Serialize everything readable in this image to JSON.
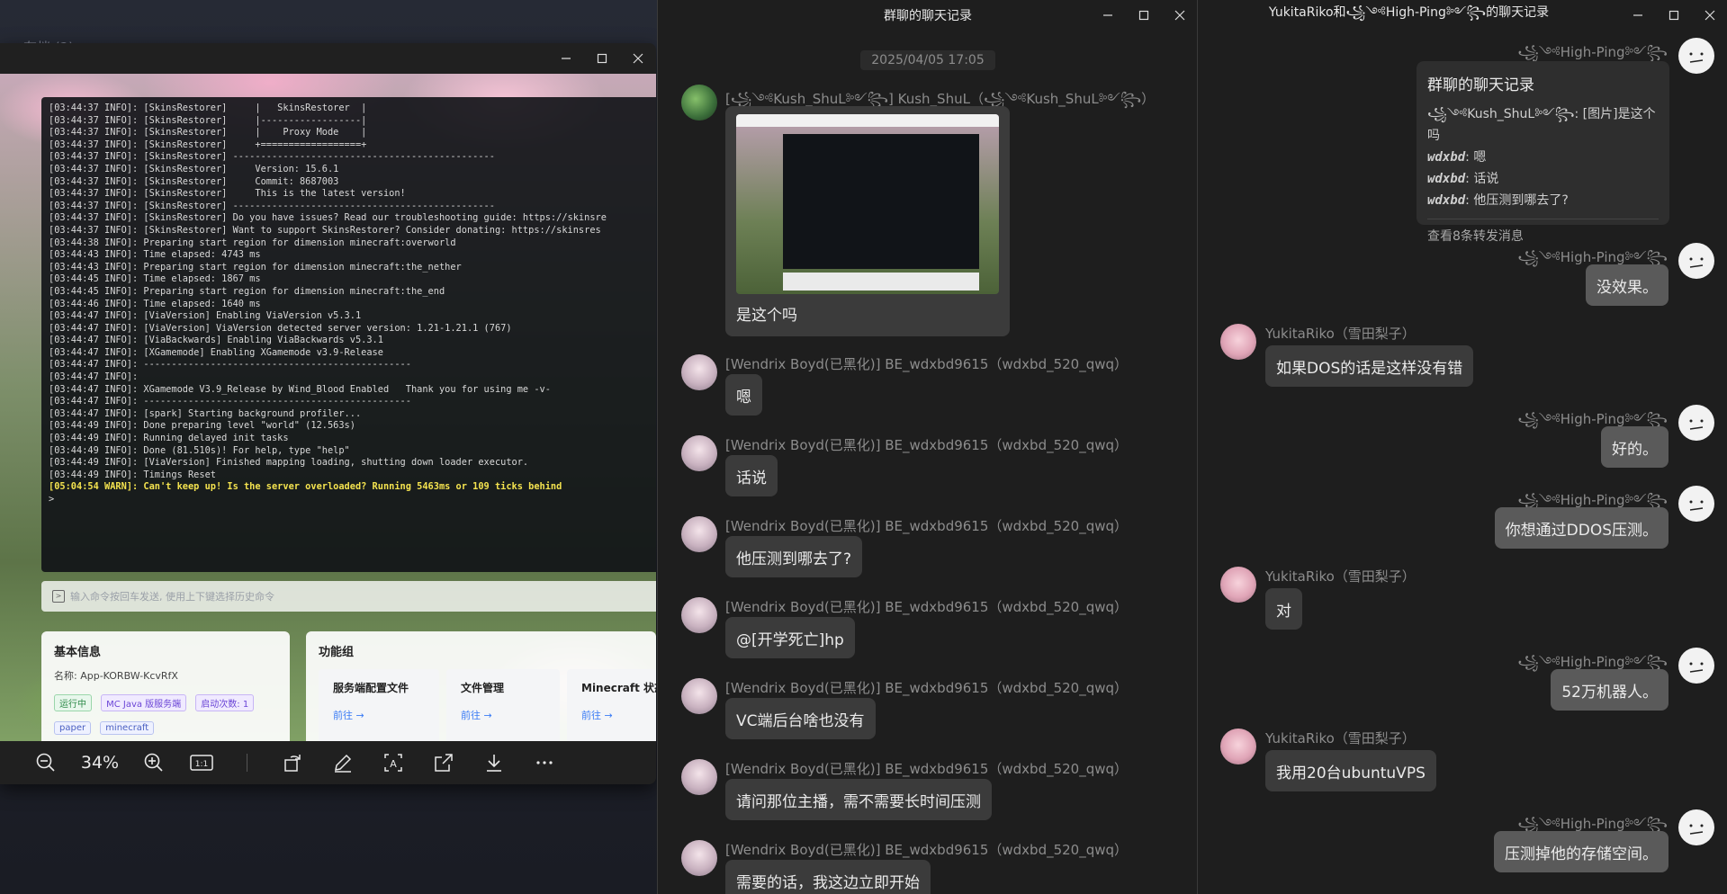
{
  "desktop": {
    "label": "存档 (2)"
  },
  "viewer": {
    "zoom": "34%",
    "console_lines": [
      "[03:44:37 INFO]: [SkinsRestorer]     |   SkinsRestorer  |",
      "[03:44:37 INFO]: [SkinsRestorer]     |------------------|",
      "[03:44:37 INFO]: [SkinsRestorer]     |    Proxy Mode    |",
      "[03:44:37 INFO]: [SkinsRestorer]     +==================+",
      "[03:44:37 INFO]: [SkinsRestorer] -----------------------------------------------",
      "[03:44:37 INFO]: [SkinsRestorer]     Version: 15.6.1",
      "[03:44:37 INFO]: [SkinsRestorer]     Commit: 8687003",
      "[03:44:37 INFO]: [SkinsRestorer]     This is the latest version!",
      "[03:44:37 INFO]: [SkinsRestorer] -----------------------------------------------",
      "[03:44:37 INFO]: [SkinsRestorer] Do you have issues? Read our troubleshooting guide: https://skinsre",
      "[03:44:37 INFO]: [SkinsRestorer] Want to support SkinsRestorer? Consider donating: https://skinsres",
      "[03:44:38 INFO]: Preparing start region for dimension minecraft:overworld",
      "[03:44:43 INFO]: Time elapsed: 4743 ms",
      "[03:44:43 INFO]: Preparing start region for dimension minecraft:the_nether",
      "[03:44:45 INFO]: Time elapsed: 1867 ms",
      "[03:44:45 INFO]: Preparing start region for dimension minecraft:the_end",
      "[03:44:46 INFO]: Time elapsed: 1640 ms",
      "[03:44:47 INFO]: [ViaVersion] Enabling ViaVersion v5.3.1",
      "[03:44:47 INFO]: [ViaVersion] ViaVersion detected server version: 1.21-1.21.1 (767)",
      "[03:44:47 INFO]: [ViaBackwards] Enabling ViaBackwards v5.3.1",
      "[03:44:47 INFO]: [XGamemode] Enabling XGamemode v3.9-Release",
      "[03:44:47 INFO]: ------------------------------------------------",
      "[03:44:47 INFO]:",
      "",
      "",
      "",
      "",
      "[03:44:47 INFO]: XGamemode V3.9_Release by Wind_Blood Enabled   Thank you for using me -v-",
      "[03:44:47 INFO]: ------------------------------------------------",
      "[03:44:47 INFO]: [spark] Starting background profiler...",
      "[03:44:49 INFO]: Done preparing level \"world\" (12.563s)",
      "[03:44:49 INFO]: Running delayed init tasks",
      "[03:44:49 INFO]: Done (81.510s)! For help, type \"help\"",
      "[03:44:49 INFO]: [ViaVersion] Finished mapping loading, shutting down loader executor.",
      "[03:44:49 INFO]: Timings Reset"
    ],
    "warn_line": "[05:04:54 WARN]: Can't keep up! Is the server overloaded? Running 5463ms or 109 ticks behind",
    "prompt": ">",
    "cmd_placeholder": "输入命令按回车发送, 使用上下键选择历史命令",
    "basic_info": {
      "title": "基本信息",
      "name_label": "名称: App-KORBW-KcvRfX",
      "tags": [
        "运行中",
        "MC Java 版服务端",
        "启动次数: 1"
      ],
      "tags_row2": [
        "paper",
        "minecraft"
      ]
    },
    "feature_group": {
      "title": "功能组",
      "items": [
        {
          "title": "服务端配置文件",
          "link": "前往 →"
        },
        {
          "title": "文件管理",
          "link": "前往 →"
        },
        {
          "title": "Minecraft 状态查",
          "link": "前往 →"
        }
      ]
    }
  },
  "group_chat": {
    "title": "群聊的聊天记录",
    "date": "2025/04/05 17:05",
    "messages": [
      {
        "sender": "[꧁༺Kush_ShuL༻꧂] Kush_ShuL（꧁༺Kush_ShuL༻꧂）",
        "text": "是这个吗",
        "avatar": "green"
      },
      {
        "sender": "[Wendrix Boyd(已黑化)] BE_wdxbd9615（wdxbd_520_qwq）",
        "text": "嗯"
      },
      {
        "sender": "[Wendrix Boyd(已黑化)] BE_wdxbd9615（wdxbd_520_qwq）",
        "text": "话说"
      },
      {
        "sender": "[Wendrix Boyd(已黑化)] BE_wdxbd9615（wdxbd_520_qwq）",
        "text": "他压测到哪去了?"
      },
      {
        "sender": "[Wendrix Boyd(已黑化)] BE_wdxbd9615（wdxbd_520_qwq）",
        "text": "@[开学死亡]hp"
      },
      {
        "sender": "[Wendrix Boyd(已黑化)] BE_wdxbd9615（wdxbd_520_qwq）",
        "text": "VC端后台啥也没有"
      },
      {
        "sender": "[Wendrix Boyd(已黑化)] BE_wdxbd9615（wdxbd_520_qwq）",
        "text": "请问那位主播，需不需要长时间压测"
      },
      {
        "sender": "[Wendrix Boyd(已黑化)] BE_wdxbd9615（wdxbd_520_qwq）",
        "text": "需要的话，我这边立即开始"
      }
    ]
  },
  "private_chat": {
    "title": "YukitaRiko和꧁༺High-Ping༻꧂的聊天记录",
    "forward_card": {
      "title": "群聊的聊天记录",
      "lines": [
        {
          "name": "꧁༺Kush_ShuL༻꧂",
          "text": ": [图片]是这个吗"
        },
        {
          "name": "wdxbd",
          "text": ": 嗯"
        },
        {
          "name": "wdxbd",
          "text": ": 话说"
        },
        {
          "name": "wdxbd",
          "text": ": 他压测到哪去了?"
        }
      ],
      "footer": "查看8条转发消息"
    },
    "high_ping_name": "꧁༺High-Ping༻꧂",
    "yukita_name": "YukitaRiko（雪田梨子）",
    "messages": [
      {
        "side": "right",
        "text": "没效果。"
      },
      {
        "side": "left",
        "text": "如果DOS的话是这样没有错"
      },
      {
        "side": "right",
        "text": "好的。"
      },
      {
        "side": "right",
        "text": "你想通过DDOS压测。"
      },
      {
        "side": "left",
        "text": "对"
      },
      {
        "side": "right",
        "text": "52万机器人。"
      },
      {
        "side": "left",
        "text": "我用20台ubuntuVPS"
      },
      {
        "side": "right",
        "text": "压测掉他的存储空间。"
      }
    ]
  }
}
